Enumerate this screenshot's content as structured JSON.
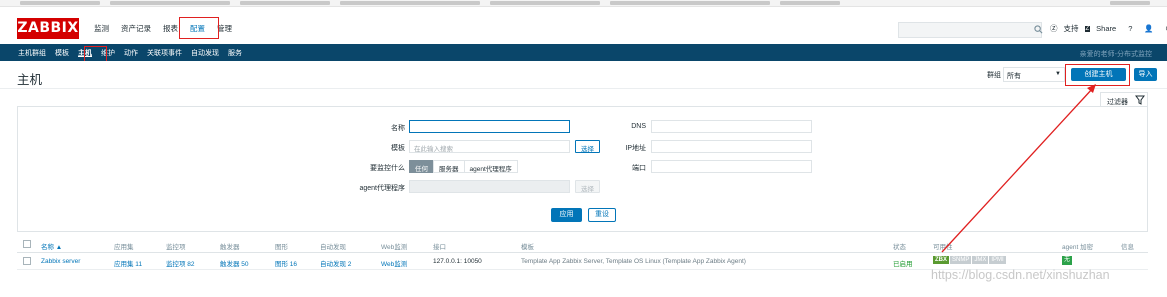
{
  "app": {
    "logo": "ZABBIX",
    "main_menu": [
      "监测",
      "资产记录",
      "报表",
      "配置",
      "管理"
    ],
    "main_menu_active": "配置",
    "topright": {
      "support": "支持",
      "share": "Share",
      "help": "?"
    }
  },
  "subnav": {
    "items": [
      "主机群组",
      "模板",
      "主机",
      "维护",
      "动作",
      "关联项事件",
      "自动发现",
      "服务"
    ],
    "active": "主机",
    "right_text": "亲爱的老师-分布式监控"
  },
  "page": {
    "title": "主机",
    "group_label": "群组",
    "group_value": "所有",
    "create_button": "创建主机",
    "import_button": "导入"
  },
  "filter": {
    "tab_label": "过滤器",
    "name_label": "名称",
    "name_value": "",
    "template_label": "模板",
    "template_placeholder": "在此输入搜索",
    "select_label": "选择",
    "monitored_by_label": "要监控什么",
    "monitored_by_options": [
      "任何",
      "服务器",
      "agent代理程序"
    ],
    "monitored_by_selected": "任何",
    "proxy_label": "agent代理程序",
    "proxy_select_label": "选择",
    "dns_label": "DNS",
    "ip_label": "IP地址",
    "port_label": "端口",
    "apply": "应用",
    "reset": "重设"
  },
  "table": {
    "headers": {
      "name": "名称 ▲",
      "applications": "应用集",
      "items": "监控项",
      "triggers": "触发器",
      "graphs": "图形",
      "discovery": "自动发现",
      "web": "Web监测",
      "interface": "接口",
      "templates": "模板",
      "status": "状态",
      "availability": "可用性",
      "encryption": "agent 加密",
      "info": "信息"
    },
    "rows": [
      {
        "name": "Zabbix server",
        "applications": "应用集 11",
        "items": "监控项 82",
        "triggers": "触发器 50",
        "graphs": "图形 16",
        "discovery": "自动发现 2",
        "web": "Web监测",
        "interface": "127.0.0.1: 10050",
        "templates": "Template App Zabbix Server, Template OS Linux (Template App Zabbix Agent)",
        "status": "已启用",
        "availability": [
          "ZBX",
          "SNMP",
          "JMX",
          "IPMI"
        ],
        "encryption": "无"
      }
    ]
  },
  "watermark": "https://blog.csdn.net/xinshuzhan",
  "colors": {
    "brand": "#d40000",
    "nav": "#0a466a",
    "accent": "#0275b8",
    "annotation": "#e02020"
  }
}
